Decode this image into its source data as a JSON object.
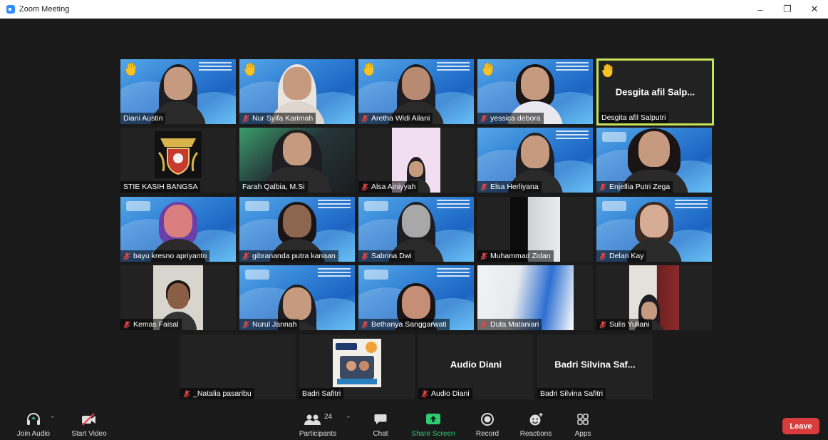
{
  "window": {
    "title": "Zoom Meeting",
    "minimize": "–",
    "restore": "❐",
    "close": "✕"
  },
  "participants": [
    {
      "name": "Diani Austin"
    },
    {
      "name": "Nur Syifa Karimah"
    },
    {
      "name": "Aretha Widi Ailani"
    },
    {
      "name": "yessica debora"
    },
    {
      "name": "Desgita afil Salputri",
      "display_name": "Desgita afil Salp..."
    },
    {
      "name": "STIE KASIH BANGSA"
    },
    {
      "name": "Farah Qalbia, M.Si"
    },
    {
      "name": "Alsa Ainiyyah"
    },
    {
      "name": "Elsa Herliyana"
    },
    {
      "name": "Enjellia Putri Zega"
    },
    {
      "name": "bayu kresno apriyanto"
    },
    {
      "name": "gibrananda putra kanaan"
    },
    {
      "name": "Sabrina Dwi"
    },
    {
      "name": "Muhammad Zidan"
    },
    {
      "name": "Delan Kay"
    },
    {
      "name": "Kemas Faisal"
    },
    {
      "name": "Nurul Jannah"
    },
    {
      "name": "Bethanya Sanggarwati"
    },
    {
      "name": "Duta Mataniari"
    },
    {
      "name": "Sulis Yuliani"
    },
    {
      "name": "_Natalia pasaribu"
    },
    {
      "name": "Badri Safitri"
    },
    {
      "name": "Audio Diani",
      "display_name": "Audio Diani"
    },
    {
      "name": "Badri Silvina Safitri",
      "display_name": "Badri Silvina Saf..."
    }
  ],
  "toolbar": {
    "join_audio": "Join Audio",
    "start_video": "Start Video",
    "participants": "Participants",
    "participants_count": "24",
    "chat": "Chat",
    "share_screen": "Share Screen",
    "record": "Record",
    "reactions": "Reactions",
    "apps": "Apps",
    "leave": "Leave"
  },
  "colors": {
    "active_speaker": "#c6e25a",
    "leave": "#d93c3c",
    "share": "#2ecc71",
    "zoom_blue": "#2d8cff"
  }
}
